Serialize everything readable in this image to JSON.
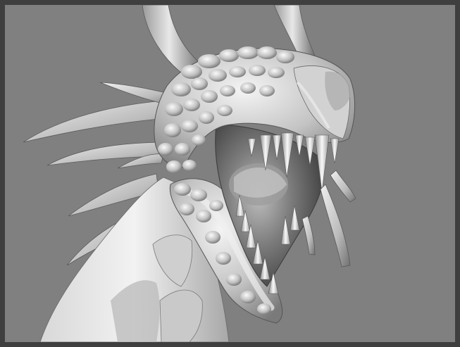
{
  "scene": {
    "subject": "",
    "palette": {
      "background": "#808080",
      "border": "#3f3f3f",
      "model_light": "#e6e6e6",
      "model_mid": "#b4b4b4",
      "model_dark": "#4a4a4a",
      "mouth_interior": "#5a5a5a"
    }
  }
}
